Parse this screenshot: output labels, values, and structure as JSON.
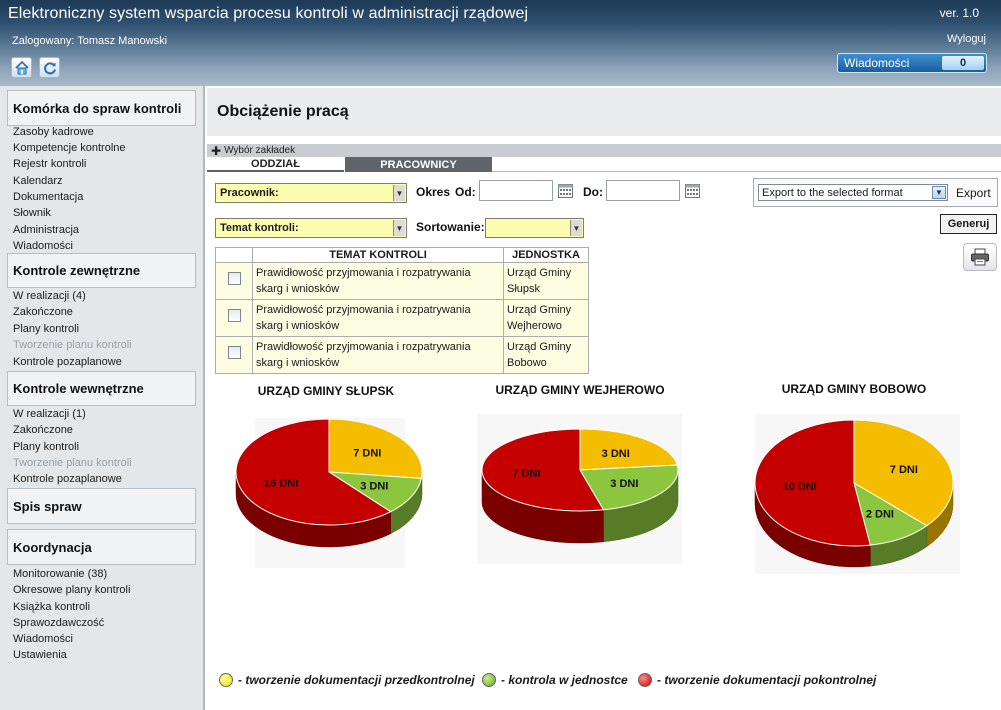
{
  "header": {
    "app_title": "Elektroniczny system wsparcia procesu kontroli w administracji rządowej",
    "version": "ver. 1.0",
    "logged_in": "Zalogowany: Tomasz Manowski",
    "logout": "Wyloguj",
    "messages_label": "Wiadomości",
    "messages_count": "0",
    "home_icon": "home-icon",
    "refresh_icon": "refresh-icon"
  },
  "sidebar": {
    "sections": [
      {
        "title": "Komórka do spraw kontroli",
        "items": [
          "Zasoby kadrowe",
          "Kompetencje kontrolne",
          "Rejestr kontroli",
          "Kalendarz",
          "Dokumentacja",
          "Słownik",
          "Administracja",
          "Wiadomości"
        ]
      },
      {
        "title": "Kontrole zewnętrzne",
        "items": [
          "W realizacji (4)",
          "Zakończone",
          "Plany kontroli",
          "Tworzenie planu kontroli",
          "Kontrole pozaplanowe"
        ]
      },
      {
        "title": "Kontrole wewnętrzne",
        "items": [
          "W realizacji (1)",
          "Zakończone",
          "Plany kontroli",
          "Tworzenie planu kontroli",
          "Kontrole pozaplanowe"
        ]
      },
      {
        "title": "Spis spraw",
        "items": []
      },
      {
        "title": "Koordynacja",
        "items": [
          "Monitorowanie (38)",
          "Okresowe plany kontroli",
          "Książka kontroli",
          "Sprawozdawczość",
          "Wiadomości",
          "Ustawienia"
        ]
      }
    ]
  },
  "main": {
    "page_title": "Obciążenie pracą",
    "tab_selector": "Wybór zakładek",
    "tabs": [
      "ODDZIAŁ",
      "PRACOWNICY"
    ],
    "active_tab": "PRACOWNICY",
    "filters": {
      "employee_select": "Pracownik:",
      "period_label": "Okres",
      "from_label": "Od:",
      "to_label": "Do:",
      "from_value": "",
      "to_value": "",
      "topic_select": "Temat kontroli:",
      "sort_label": "Sortowanie:",
      "sort_value": ""
    },
    "export": {
      "select_value": "Export to the selected format",
      "button": "Export"
    },
    "generate_button": "Generuj",
    "print_icon": "print-icon",
    "table": {
      "headers": [
        "TEMAT KONTROLI",
        "JEDNOSTKA"
      ],
      "rows": [
        {
          "topic": "Prawidłowość przyjmowania i rozpatrywania skarg i wniosków",
          "unit": "Urząd Gminy Słupsk"
        },
        {
          "topic": "Prawidłowość przyjmowania i rozpatrywania skarg i wniosków",
          "unit": "Urząd Gminy Wejherowo"
        },
        {
          "topic": "Prawidłowość przyjmowania i rozpatrywania skarg i wniosków",
          "unit": "Urząd Gminy Bobowo"
        }
      ]
    },
    "legend": [
      {
        "label": "- tworzenie dokumentacji przedkontrolnej",
        "color": "#f5c400"
      },
      {
        "label": "- kontrola w jednostce",
        "color": "#8bc43f"
      },
      {
        "label": "- tworzenie dokumentacji pokontrolnej",
        "color": "#cc0d0d"
      }
    ]
  },
  "chart_data": [
    {
      "type": "pie",
      "title": "URZĄD GMINY SŁUPSK",
      "categories": [
        "- tworzenie dokumentacji przedkontrolnej",
        "- kontrola w jednostce",
        "- tworzenie dokumentacji pokontrolnej"
      ],
      "values": [
        7,
        3,
        16
      ],
      "labels": [
        "7 DNI",
        "3 DNI",
        "16 DNI"
      ],
      "colors": [
        "#f5bd00",
        "#8cc63f",
        "#c40000"
      ]
    },
    {
      "type": "pie",
      "title": "URZĄD GMINY WEJHEROWO",
      "categories": [
        "- tworzenie dokumentacji przedkontrolnej",
        "- kontrola w jednostce",
        "- tworzenie dokumentacji pokontrolnej"
      ],
      "values": [
        3,
        3,
        7
      ],
      "labels": [
        "3 DNI",
        "3 DNI",
        "7 DNI"
      ],
      "colors": [
        "#f5bd00",
        "#8cc63f",
        "#c40000"
      ]
    },
    {
      "type": "pie",
      "title": "URZĄD GMINY BOBOWO",
      "categories": [
        "- tworzenie dokumentacji przedkontrolnej",
        "- kontrola w jednostce",
        "- tworzenie dokumentacji pokontrolnej"
      ],
      "values": [
        7,
        2,
        10
      ],
      "labels": [
        "7 DNI",
        "2 DNI",
        "10 DNI"
      ],
      "colors": [
        "#f5bd00",
        "#8cc63f",
        "#c40000"
      ]
    }
  ]
}
